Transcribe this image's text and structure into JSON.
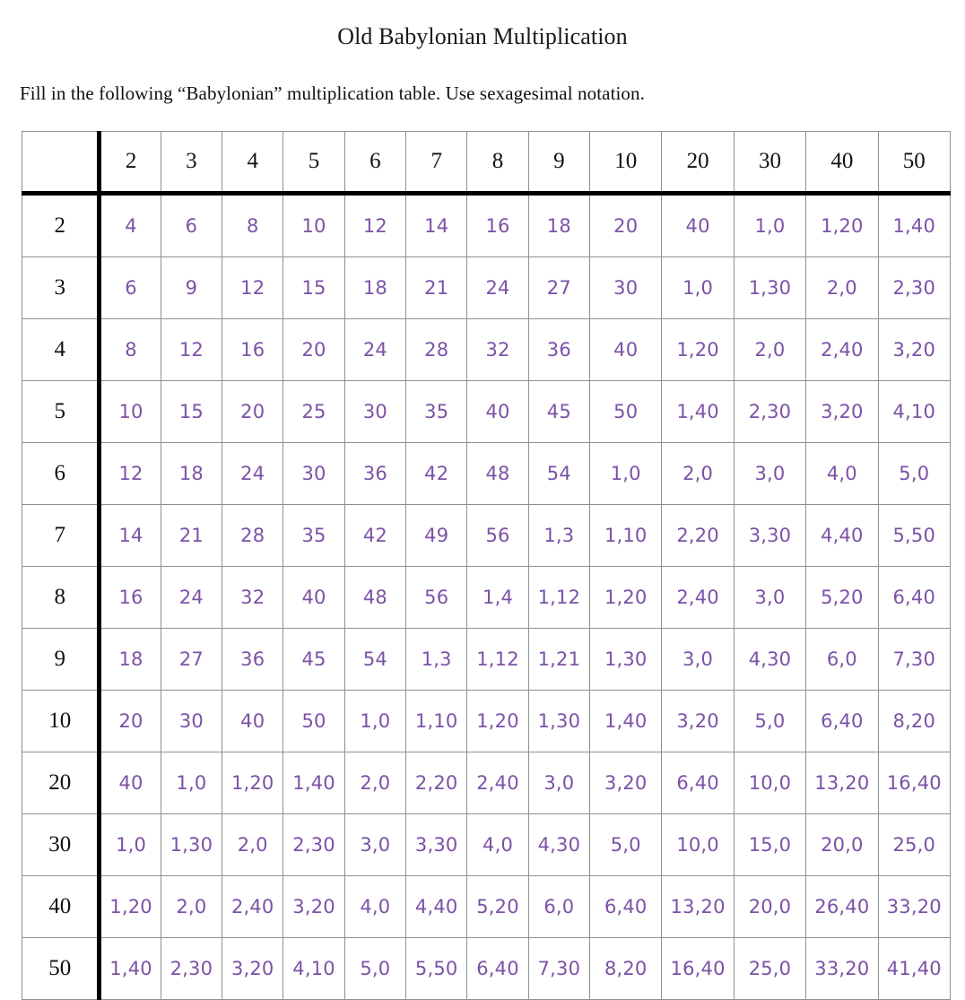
{
  "document": {
    "title": "Old Babylonian Multiplication",
    "instruction": "Fill in the following “Babylonian” multiplication table.  Use sexagesimal notation."
  },
  "colors": {
    "value_text": "#7b52a6",
    "header_text": "#111111",
    "grid_line": "#8f8f8f",
    "heavy_rule": "#000000",
    "page_background": "#ffffff"
  },
  "table": {
    "corner_label": "",
    "column_headers": [
      "2",
      "3",
      "4",
      "5",
      "6",
      "7",
      "8",
      "9",
      "10",
      "20",
      "30",
      "40",
      "50"
    ],
    "row_headers": [
      "2",
      "3",
      "4",
      "5",
      "6",
      "7",
      "8",
      "9",
      "10",
      "20",
      "30",
      "40",
      "50"
    ],
    "rows": [
      {
        "header": "2",
        "values": [
          "4",
          "6",
          "8",
          "10",
          "12",
          "14",
          "16",
          "18",
          "20",
          "40",
          "1,0",
          "1,20",
          "1,40"
        ]
      },
      {
        "header": "3",
        "values": [
          "6",
          "9",
          "12",
          "15",
          "18",
          "21",
          "24",
          "27",
          "30",
          "1,0",
          "1,30",
          "2,0",
          "2,30"
        ]
      },
      {
        "header": "4",
        "values": [
          "8",
          "12",
          "16",
          "20",
          "24",
          "28",
          "32",
          "36",
          "40",
          "1,20",
          "2,0",
          "2,40",
          "3,20"
        ]
      },
      {
        "header": "5",
        "values": [
          "10",
          "15",
          "20",
          "25",
          "30",
          "35",
          "40",
          "45",
          "50",
          "1,40",
          "2,30",
          "3,20",
          "4,10"
        ]
      },
      {
        "header": "6",
        "values": [
          "12",
          "18",
          "24",
          "30",
          "36",
          "42",
          "48",
          "54",
          "1,0",
          "2,0",
          "3,0",
          "4,0",
          "5,0"
        ]
      },
      {
        "header": "7",
        "values": [
          "14",
          "21",
          "28",
          "35",
          "42",
          "49",
          "56",
          "1,3",
          "1,10",
          "2,20",
          "3,30",
          "4,40",
          "5,50"
        ]
      },
      {
        "header": "8",
        "values": [
          "16",
          "24",
          "32",
          "40",
          "48",
          "56",
          "1,4",
          "1,12",
          "1,20",
          "2,40",
          "3,0",
          "5,20",
          "6,40"
        ]
      },
      {
        "header": "9",
        "values": [
          "18",
          "27",
          "36",
          "45",
          "54",
          "1,3",
          "1,12",
          "1,21",
          "1,30",
          "3,0",
          "4,30",
          "6,0",
          "7,30"
        ]
      },
      {
        "header": "10",
        "values": [
          "20",
          "30",
          "40",
          "50",
          "1,0",
          "1,10",
          "1,20",
          "1,30",
          "1,40",
          "3,20",
          "5,0",
          "6,40",
          "8,20"
        ]
      },
      {
        "header": "20",
        "values": [
          "40",
          "1,0",
          "1,20",
          "1,40",
          "2,0",
          "2,20",
          "2,40",
          "3,0",
          "3,20",
          "6,40",
          "10,0",
          "13,20",
          "16,40"
        ]
      },
      {
        "header": "30",
        "values": [
          "1,0",
          "1,30",
          "2,0",
          "2,30",
          "3,0",
          "3,30",
          "4,0",
          "4,30",
          "5,0",
          "10,0",
          "15,0",
          "20,0",
          "25,0"
        ]
      },
      {
        "header": "40",
        "values": [
          "1,20",
          "2,0",
          "2,40",
          "3,20",
          "4,0",
          "4,40",
          "5,20",
          "6,0",
          "6,40",
          "13,20",
          "20,0",
          "26,40",
          "33,20"
        ]
      },
      {
        "header": "50",
        "values": [
          "1,40",
          "2,30",
          "3,20",
          "4,10",
          "5,0",
          "5,50",
          "6,40",
          "7,30",
          "8,20",
          "16,40",
          "25,0",
          "33,20",
          "41,40"
        ]
      }
    ]
  }
}
